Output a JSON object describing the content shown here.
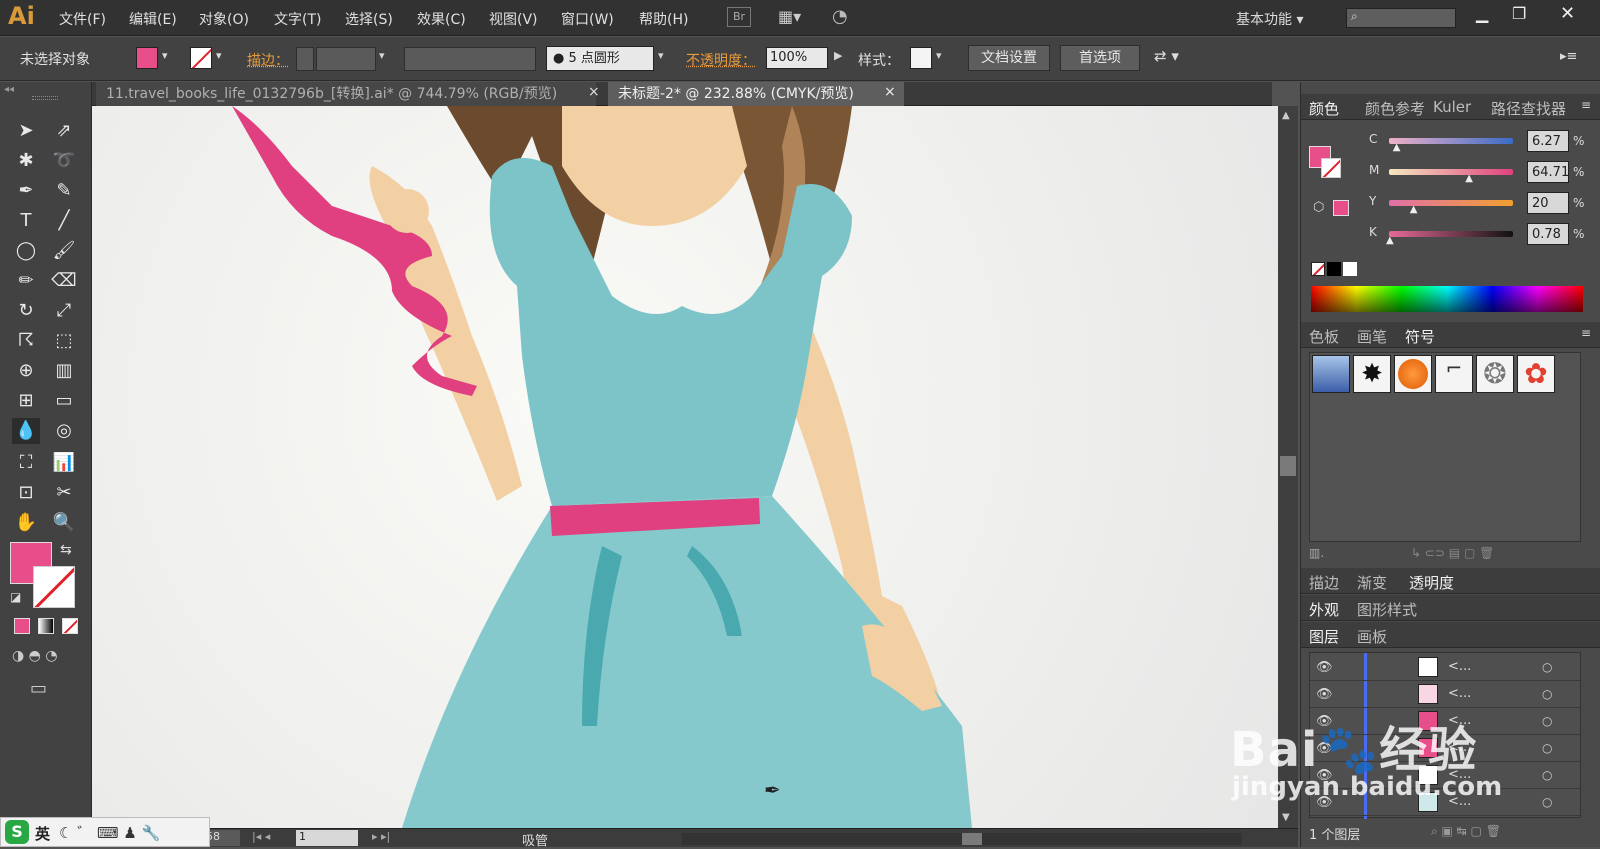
{
  "app": {
    "logo": "Ai"
  },
  "menu": [
    "文件(F)",
    "编辑(E)",
    "对象(O)",
    "文字(T)",
    "选择(S)",
    "效果(C)",
    "视图(V)",
    "窗口(W)",
    "帮助(H)"
  ],
  "menu_extras": {
    "bridge": "Br",
    "workspace": "基本功能",
    "search_placeholder": ""
  },
  "control": {
    "selection_label": "未选择对象",
    "stroke_label": "描边：",
    "brush_label": "5 点圆形",
    "opacity_label": "不透明度：",
    "opacity_value": "100%",
    "style_label": "样式：",
    "doc_setup": "文档设置",
    "preferences": "首选项"
  },
  "tabs": [
    {
      "label": "11.travel_books_life_0132796b_[转换].ai* @ 744.79% (RGB/预览)",
      "close": "×"
    },
    {
      "label": "未标题-2* @ 232.88% (CMYK/预览)",
      "close": "×"
    }
  ],
  "colors": {
    "fill": "#e84e8a",
    "dress": "#85c9cd",
    "belt": "#e0407f",
    "skin": "#f2d0a4",
    "hair": "#8b5e34"
  },
  "color_panel": {
    "tabs": [
      "颜色",
      "颜色参考",
      "Kuler",
      "路径查找器"
    ],
    "channels": [
      {
        "name": "C",
        "value": "6.27",
        "unit": "%",
        "level": 0.0627
      },
      {
        "name": "M",
        "value": "64.71",
        "unit": "%",
        "level": 0.6471
      },
      {
        "name": "Y",
        "value": "20",
        "unit": "%",
        "level": 0.2
      },
      {
        "name": "K",
        "value": "0.78",
        "unit": "%",
        "level": 0.0078
      }
    ]
  },
  "symbols_panel": {
    "tabs": [
      "色板",
      "画笔",
      "符号"
    ]
  },
  "panel_groups": [
    {
      "tabs": [
        "描边",
        "渐变",
        "透明度"
      ]
    },
    {
      "tabs": [
        "外观",
        "图形样式"
      ]
    },
    {
      "tabs": [
        "图层",
        "画板"
      ]
    }
  ],
  "layers": {
    "rows": [
      "<...",
      "<...",
      "<...",
      "<...",
      "<...",
      "<..."
    ],
    "footer": "1 个图层"
  },
  "status": {
    "zoom": "58",
    "page": "1",
    "tool": "吸管"
  },
  "watermark": {
    "brand": "Bai",
    "brand2": "经验",
    "url": "jingyan.baidu.com"
  },
  "ime": {
    "mode": "英"
  }
}
